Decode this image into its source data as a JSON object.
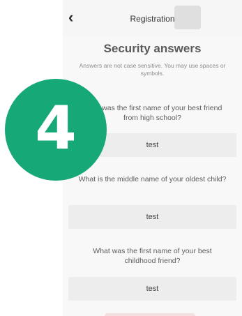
{
  "badge": {
    "number": "4",
    "color": "#16a877"
  },
  "header": {
    "title": "Registration",
    "back_icon": "chevron-left-icon"
  },
  "page": {
    "heading": "Security answers",
    "helper": "Answers are not case sensitive. You may use spaces or symbols."
  },
  "questions": [
    {
      "question": "What was the first name of your best friend from high school?",
      "answer": "test"
    },
    {
      "question": "What is the middle name of your oldest child?",
      "answer": "test"
    },
    {
      "question": "What was the first name of your best childhood friend?",
      "answer": "test"
    }
  ]
}
